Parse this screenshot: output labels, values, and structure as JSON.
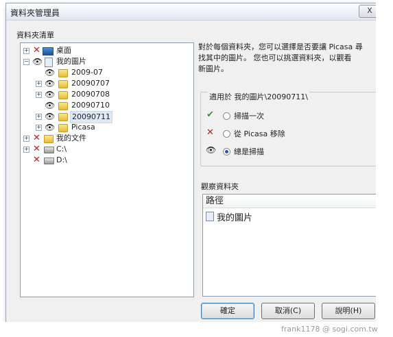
{
  "window": {
    "title": "資料夾管理員",
    "close_label": "X"
  },
  "tree": {
    "label": "資料夾清單",
    "nodes": [
      {
        "name": "桌面",
        "state": "excluded",
        "icon": "desktop-icon"
      },
      {
        "name": "我的圖片",
        "state": "watched",
        "icon": "pictures-icon"
      },
      {
        "name": "2009-07",
        "state": "watched",
        "icon": "folder-icon"
      },
      {
        "name": "20090707",
        "state": "watched",
        "icon": "folder-icon"
      },
      {
        "name": "20090708",
        "state": "watched",
        "icon": "folder-icon"
      },
      {
        "name": "20090710",
        "state": "watched",
        "icon": "folder-icon"
      },
      {
        "name": "20090711",
        "state": "watched",
        "icon": "folder-icon",
        "selected": true
      },
      {
        "name": "Picasa",
        "state": "watched",
        "icon": "folder-icon"
      },
      {
        "name": "我的文件",
        "state": "excluded",
        "icon": "folder-icon"
      },
      {
        "name": "C:\\",
        "state": "excluded",
        "icon": "drive-icon"
      },
      {
        "name": "D:\\",
        "state": "excluded",
        "icon": "drive-icon"
      }
    ]
  },
  "description": {
    "line1": "對於每個資料夾，您可以選擇是否要讓 Picasa 尋",
    "line2": "找其中的圖片。 您也可以挑選資料夾，以觀看",
    "line3": "新圖片。"
  },
  "options": {
    "group_title": "適用於 我的圖片\\20090711\\",
    "scan_once": "掃描一次",
    "remove": "從 Picasa 移除",
    "always_scan": "總是掃描",
    "selected": "always_scan"
  },
  "watched": {
    "label": "觀察資料夾",
    "column": "路徑",
    "items": [
      "我的圖片"
    ]
  },
  "buttons": {
    "ok": "確定",
    "cancel": "取消(C)",
    "help": "說明(H)"
  },
  "watermark": "frank1178 @ sogi.com.tw",
  "colors": {
    "excluded": "#b52020",
    "check": "#2e9a2e",
    "accent": "#3c7fb1"
  }
}
